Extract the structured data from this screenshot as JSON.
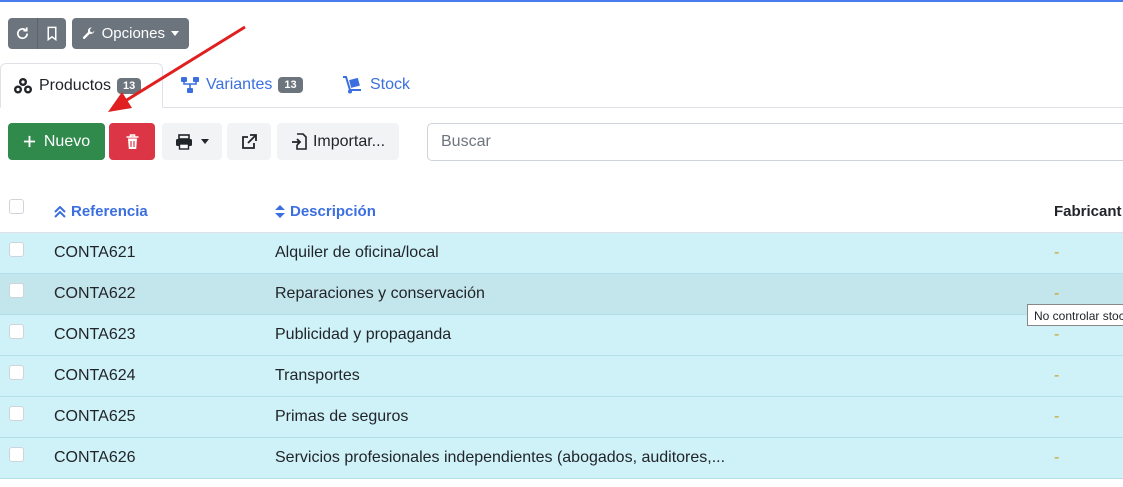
{
  "toolbar": {
    "options_label": "Opciones"
  },
  "tabs": [
    {
      "label": "Productos",
      "count": "13"
    },
    {
      "label": "Variantes",
      "count": "13"
    },
    {
      "label": "Stock"
    }
  ],
  "actions": {
    "new_label": "Nuevo",
    "import_label": "Importar..."
  },
  "search": {
    "placeholder": "Buscar"
  },
  "table": {
    "headers": {
      "reference": "Referencia",
      "description": "Descripción",
      "manufacturer": "Fabricant"
    },
    "rows": [
      {
        "reference": "CONTA621",
        "description": "Alquiler de oficina/local",
        "manufacturer": "-"
      },
      {
        "reference": "CONTA622",
        "description": "Reparaciones y conservación",
        "manufacturer": "-"
      },
      {
        "reference": "CONTA623",
        "description": "Publicidad y propaganda",
        "manufacturer": "-"
      },
      {
        "reference": "CONTA624",
        "description": "Transportes",
        "manufacturer": "-"
      },
      {
        "reference": "CONTA625",
        "description": "Primas de seguros",
        "manufacturer": "-"
      },
      {
        "reference": "CONTA626",
        "description": "Servicios profesionales independientes (abogados, auditores,...",
        "manufacturer": "-"
      }
    ]
  },
  "tooltip": {
    "text": "No controlar stoc"
  },
  "colors": {
    "accent": "#3b6fe0",
    "success": "#2f8a4c",
    "danger": "#dc3545",
    "row_bg": "#cff2f9",
    "annotation_arrow": "#e02020"
  }
}
